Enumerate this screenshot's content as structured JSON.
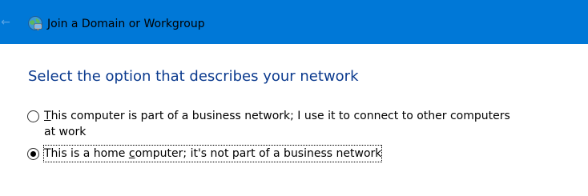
{
  "window": {
    "title": "Join a Domain or Workgroup",
    "back_icon": "arrow-left-icon",
    "app_icon": "network-computers-icon",
    "accent_color": "#0078d7"
  },
  "main": {
    "heading": "Select the option that describes your network",
    "heading_color": "#0b3a8e",
    "options": [
      {
        "mnemonic": "T",
        "label_rest": "his computer is part of a business network; I use it to connect to other computers at work",
        "selected": false
      },
      {
        "label_before": "This is a home ",
        "mnemonic": "c",
        "label_after": "omputer; it's not part of a business network",
        "selected": true
      }
    ]
  }
}
